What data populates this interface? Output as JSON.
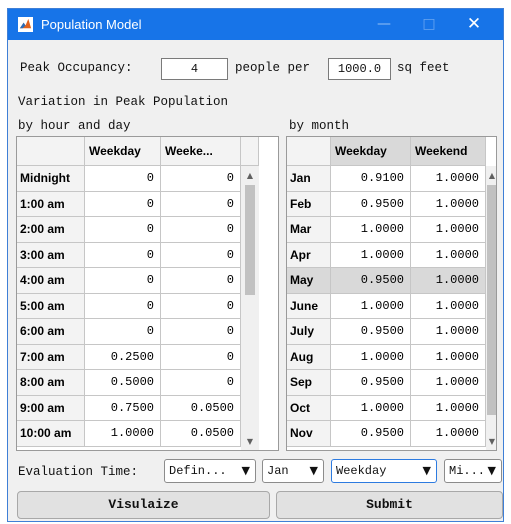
{
  "window": {
    "title": "Population Model",
    "icon": "matlab-icon",
    "controls": {
      "minimize": "—",
      "maximize": "□",
      "close": "✕"
    }
  },
  "occupancy": {
    "label": "Peak Occupancy:",
    "people_value": "4",
    "people_per_label": "people per",
    "area_value": "1000.0",
    "unit_label": "sq feet"
  },
  "variation_label": "Variation in Peak Population",
  "hourly": {
    "section_label": "by hour and day",
    "columns": [
      "Weekday",
      "Weeke..."
    ],
    "rows": [
      {
        "label": "Midnight",
        "weekday": "0",
        "weekend": "0"
      },
      {
        "label": "1:00 am",
        "weekday": "0",
        "weekend": "0"
      },
      {
        "label": "2:00 am",
        "weekday": "0",
        "weekend": "0"
      },
      {
        "label": "3:00 am",
        "weekday": "0",
        "weekend": "0"
      },
      {
        "label": "4:00 am",
        "weekday": "0",
        "weekend": "0"
      },
      {
        "label": "5:00 am",
        "weekday": "0",
        "weekend": "0"
      },
      {
        "label": "6:00 am",
        "weekday": "0",
        "weekend": "0"
      },
      {
        "label": "7:00 am",
        "weekday": "0.2500",
        "weekend": "0"
      },
      {
        "label": "8:00 am",
        "weekday": "0.5000",
        "weekend": "0"
      },
      {
        "label": "9:00 am",
        "weekday": "0.7500",
        "weekend": "0.0500"
      },
      {
        "label": "10:00 am",
        "weekday": "1.0000",
        "weekend": "0.0500"
      }
    ]
  },
  "monthly": {
    "section_label": "by month",
    "columns": [
      "Weekday",
      "Weekend"
    ],
    "selected_row": "May",
    "rows": [
      {
        "label": "Jan",
        "weekday": "0.9100",
        "weekend": "1.0000"
      },
      {
        "label": "Feb",
        "weekday": "0.9500",
        "weekend": "1.0000"
      },
      {
        "label": "Mar",
        "weekday": "1.0000",
        "weekend": "1.0000"
      },
      {
        "label": "Apr",
        "weekday": "1.0000",
        "weekend": "1.0000"
      },
      {
        "label": "May",
        "weekday": "0.9500",
        "weekend": "1.0000"
      },
      {
        "label": "June",
        "weekday": "1.0000",
        "weekend": "1.0000"
      },
      {
        "label": "July",
        "weekday": "0.9500",
        "weekend": "1.0000"
      },
      {
        "label": "Aug",
        "weekday": "1.0000",
        "weekend": "1.0000"
      },
      {
        "label": "Sep",
        "weekday": "0.9500",
        "weekend": "1.0000"
      },
      {
        "label": "Oct",
        "weekday": "1.0000",
        "weekend": "1.0000"
      },
      {
        "label": "Nov",
        "weekday": "0.9500",
        "weekend": "1.0000"
      }
    ]
  },
  "evaluation": {
    "label": "Evaluation Time:",
    "dropdowns": [
      "Defin...",
      "Jan",
      "Weekday",
      "Mi..."
    ]
  },
  "buttons": {
    "visualize": "Visulaize",
    "submit": "Submit"
  },
  "colors": {
    "titlebar": "#1774e8",
    "selected_row": "#d9d9d9",
    "focus_border": "#2d7be0"
  }
}
